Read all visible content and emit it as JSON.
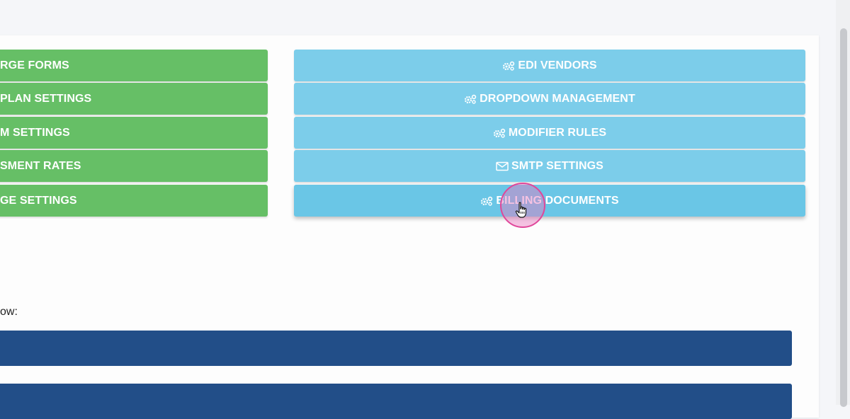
{
  "left_buttons": [
    {
      "label": "RGE FORMS"
    },
    {
      "label": "PLAN SETTINGS"
    },
    {
      "label": "M SETTINGS"
    },
    {
      "label": "SMENT RATES"
    },
    {
      "label": "GE SETTINGS"
    }
  ],
  "right_buttons": [
    {
      "label": "EDI VENDORS",
      "icon": "cogs-icon"
    },
    {
      "label": "DROPDOWN MANAGEMENT",
      "icon": "cogs-icon"
    },
    {
      "label": "MODIFIER RULES",
      "icon": "cogs-icon"
    },
    {
      "label": "SMTP SETTINGS",
      "icon": "envelope-icon"
    },
    {
      "label": "BILLING DOCUMENTS",
      "icon": "cogs-icon"
    }
  ],
  "caption": "ow:",
  "colors": {
    "green": "#66bf66",
    "blue": "#7ccdea",
    "navy": "#224e88",
    "click_highlight": "#e0479a"
  }
}
